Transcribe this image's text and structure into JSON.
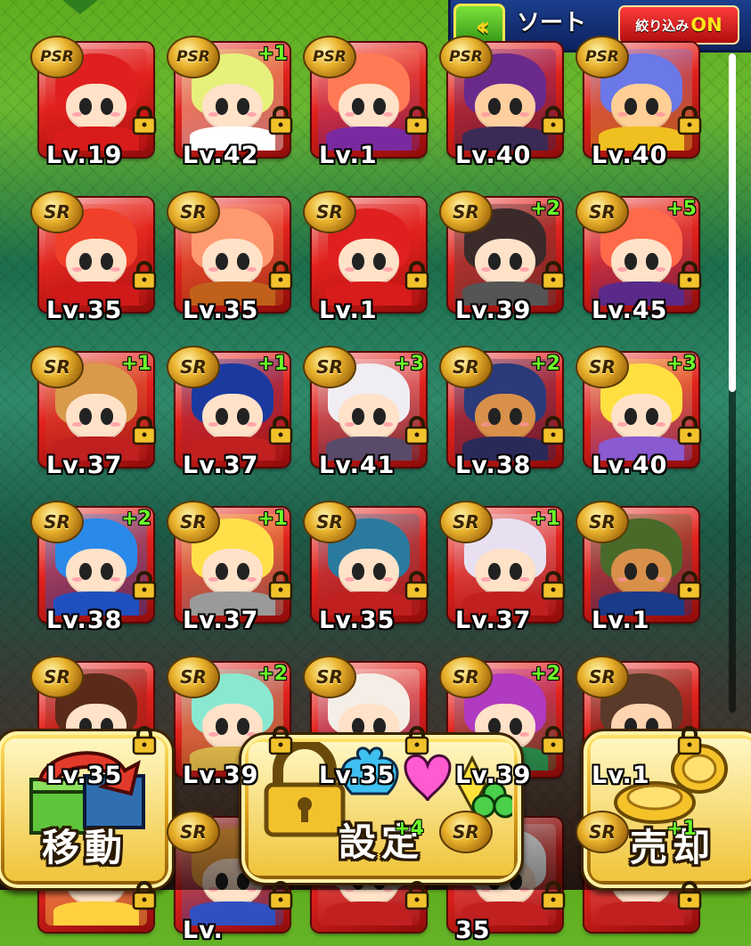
{
  "header": {
    "back_icon": "double-chevron-left-icon",
    "sort_label": "ソート",
    "filter_label": "絞り込み",
    "filter_state": "ON"
  },
  "cards": [
    {
      "rarity": "PSR",
      "plus": "",
      "level": "Lv.19",
      "hair": "#e02020",
      "skin": "#ffe2c8",
      "outfit": "#d81b1b"
    },
    {
      "rarity": "PSR",
      "plus": "+1",
      "level": "Lv.42",
      "hair": "#e6f07a",
      "skin": "#ffe2c8",
      "outfit": "#ffffff"
    },
    {
      "rarity": "PSR",
      "plus": "",
      "level": "Lv.1",
      "hair": "#ff7a55",
      "skin": "#ffe2c8",
      "outfit": "#7a2aa0"
    },
    {
      "rarity": "PSR",
      "plus": "",
      "level": "Lv.40",
      "hair": "#6a2a8c",
      "skin": "#ffcfa0",
      "outfit": "#3b2a55"
    },
    {
      "rarity": "PSR",
      "plus": "",
      "level": "Lv.40",
      "hair": "#6a78e8",
      "skin": "#ffcf95",
      "outfit": "#f0c020"
    },
    {
      "rarity": "SR",
      "plus": "",
      "level": "Lv.35",
      "hair": "#f0402a",
      "skin": "#ffe2c8",
      "outfit": "#d01a1a"
    },
    {
      "rarity": "SR",
      "plus": "",
      "level": "Lv.35",
      "hair": "#ff9a70",
      "skin": "#ffe2c8",
      "outfit": "#c0601a"
    },
    {
      "rarity": "SR",
      "plus": "",
      "level": "Lv.1",
      "hair": "#e02020",
      "skin": "#ffe2c8",
      "outfit": "#d81b1b"
    },
    {
      "rarity": "SR",
      "plus": "+2",
      "level": "Lv.39",
      "hair": "#3a2a2a",
      "skin": "#ffe2c8",
      "outfit": "#555555"
    },
    {
      "rarity": "SR",
      "plus": "+5",
      "level": "Lv.45",
      "hair": "#ff6a4a",
      "skin": "#ffe2c8",
      "outfit": "#5a2a8a"
    },
    {
      "rarity": "SR",
      "plus": "+1",
      "level": "Lv.37",
      "hair": "#d99a4a",
      "skin": "#ffe2c8",
      "outfit": "#c02020"
    },
    {
      "rarity": "SR",
      "plus": "+1",
      "level": "Lv.37",
      "hair": "#1a3aa0",
      "skin": "#ffe2c8",
      "outfit": "#c02020"
    },
    {
      "rarity": "SR",
      "plus": "+3",
      "level": "Lv.41",
      "hair": "#f0eef2",
      "skin": "#ffe2c8",
      "outfit": "#5a4a6a"
    },
    {
      "rarity": "SR",
      "plus": "+2",
      "level": "Lv.38",
      "hair": "#2a3a7a",
      "skin": "#d8904a",
      "outfit": "#2a2a5a"
    },
    {
      "rarity": "SR",
      "plus": "+3",
      "level": "Lv.40",
      "hair": "#ffe040",
      "skin": "#ffe2c8",
      "outfit": "#8a5ad0"
    },
    {
      "rarity": "SR",
      "plus": "+2",
      "level": "Lv.38",
      "hair": "#2a8aea",
      "skin": "#ffe2c8",
      "outfit": "#2050c0"
    },
    {
      "rarity": "SR",
      "plus": "+1",
      "level": "Lv.37",
      "hair": "#ffe04a",
      "skin": "#ffe2c8",
      "outfit": "#9a9a9a"
    },
    {
      "rarity": "SR",
      "plus": "",
      "level": "Lv.35",
      "hair": "#2a7aa0",
      "skin": "#ffe2c8",
      "outfit": "#c02020"
    },
    {
      "rarity": "SR",
      "plus": "+1",
      "level": "Lv.37",
      "hair": "#e8e0f0",
      "skin": "#ffe2c8",
      "outfit": "#c02020"
    },
    {
      "rarity": "SR",
      "plus": "",
      "level": "Lv.1",
      "hair": "#4a6a2a",
      "skin": "#d8904a",
      "outfit": "#1a3a8a"
    },
    {
      "rarity": "SR",
      "plus": "",
      "level": "Lv.35",
      "hair": "#5a2a1a",
      "skin": "#ffe2c8",
      "outfit": "#c02020"
    },
    {
      "rarity": "SR",
      "plus": "+2",
      "level": "Lv.39",
      "hair": "#8ae8d0",
      "skin": "#ffe2c8",
      "outfit": "#e0b84a"
    },
    {
      "rarity": "SR",
      "plus": "",
      "level": "Lv.35",
      "hair": "#f4eee6",
      "skin": "#ffe2c8",
      "outfit": "#6a3a9a"
    },
    {
      "rarity": "SR",
      "plus": "+2",
      "level": "Lv.39",
      "hair": "#b03ac0",
      "skin": "#ffe2c8",
      "outfit": "#2a8a4a"
    },
    {
      "rarity": "SR",
      "plus": "",
      "level": "Lv.1",
      "hair": "#5a3a2a",
      "skin": "#ffd4b0",
      "outfit": "#1a1a1a"
    },
    {
      "rarity": "",
      "plus": "",
      "level": "",
      "hair": "#ffffff",
      "skin": "#ffe2c8",
      "outfit": "#ffd040"
    },
    {
      "rarity": "SR",
      "plus": "",
      "level": "Lv.",
      "hair": "#e89a3a",
      "skin": "#ffe2c8",
      "outfit": "#3050c0"
    },
    {
      "rarity": "",
      "plus": "+4",
      "level": "",
      "hair": "#ffffff",
      "skin": "#ffe2c8",
      "outfit": "#c02020"
    },
    {
      "rarity": "SR",
      "plus": "",
      "level": "35",
      "hair": "#ffffff",
      "skin": "#ffe2c8",
      "outfit": "#c02020"
    },
    {
      "rarity": "SR",
      "plus": "+1",
      "level": "",
      "hair": "#ffffff",
      "skin": "#ffe2c8",
      "outfit": "#c02020"
    }
  ],
  "actions": {
    "move_label": "移動",
    "lockset_label": "設定",
    "sell_label": "売却"
  },
  "colors": {
    "accent_green": "#6dff2a",
    "filter_red": "#d81b1b",
    "filter_on": "#ffe41a",
    "gold": "#e9b22c"
  }
}
